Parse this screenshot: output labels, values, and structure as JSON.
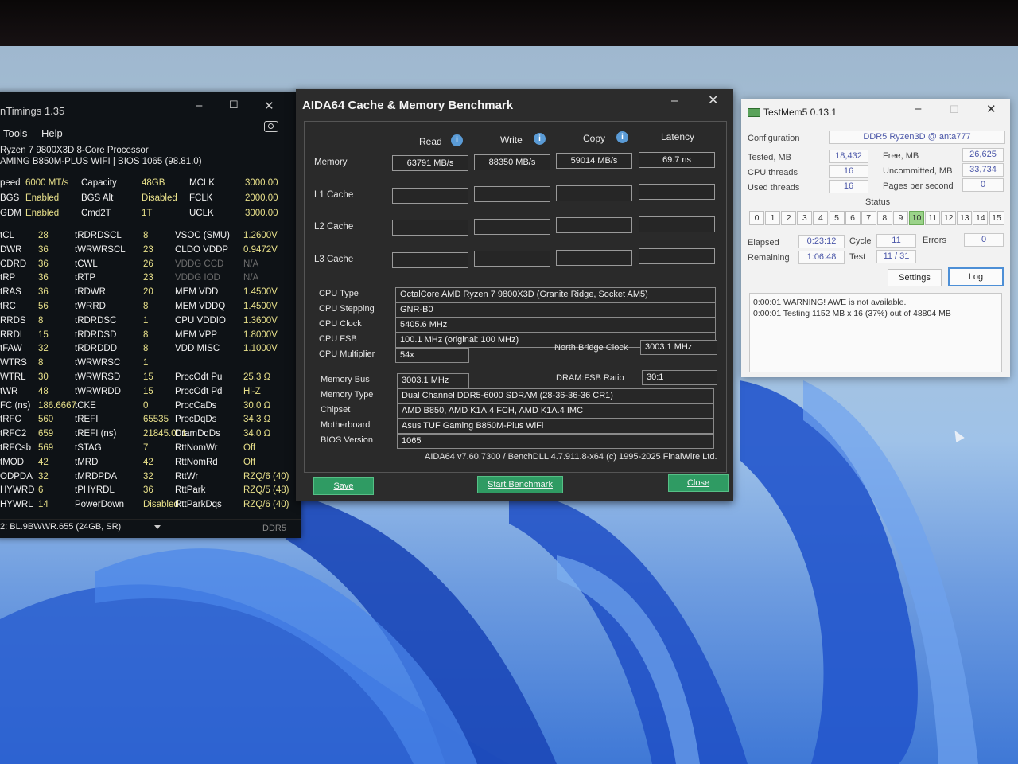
{
  "zentimings": {
    "title": "nTimings 1.35",
    "menu": [
      "Tools",
      "Help"
    ],
    "cpu": "Ryzen 7 9800X3D 8-Core Processor",
    "board": "AMING B850M-PLUS WIFI | BIOS 1065 (98.81.0)",
    "info_rows": [
      [
        [
          "peed",
          "6000 MT/s"
        ],
        [
          "Capacity",
          "48GB"
        ],
        [
          "MCLK",
          "3000.00"
        ]
      ],
      [
        [
          "BGS",
          "Enabled"
        ],
        [
          "BGS Alt",
          "Disabled"
        ],
        [
          "FCLK",
          "2000.00"
        ]
      ],
      [
        [
          "GDM",
          "Enabled"
        ],
        [
          "Cmd2T",
          "1T"
        ],
        [
          "UCLK",
          "3000.00"
        ]
      ]
    ],
    "timing_rows": [
      [
        [
          "tCL",
          "28"
        ],
        [
          "tRDRDSCL",
          "8"
        ],
        [
          "VSOC (SMU)",
          "1.2600V"
        ]
      ],
      [
        [
          "DWR",
          "36"
        ],
        [
          "tWRWRSCL",
          "23"
        ],
        [
          "CLDO VDDP",
          "0.9472V"
        ]
      ],
      [
        [
          "CDRD",
          "36"
        ],
        [
          "tCWL",
          "26"
        ],
        [
          "VDDG CCD",
          "N/A"
        ]
      ],
      [
        [
          "tRP",
          "36"
        ],
        [
          "tRTP",
          "23"
        ],
        [
          "VDDG IOD",
          "N/A"
        ]
      ],
      [
        [
          "tRAS",
          "36"
        ],
        [
          "tRDWR",
          "20"
        ],
        [
          "MEM VDD",
          "1.4500V"
        ]
      ],
      [
        [
          "tRC",
          "56"
        ],
        [
          "tWRRD",
          "8"
        ],
        [
          "MEM VDDQ",
          "1.4500V"
        ]
      ],
      [
        [
          "RRDS",
          "8"
        ],
        [
          "tRDRDSC",
          "1"
        ],
        [
          "CPU VDDIO",
          "1.3600V"
        ]
      ],
      [
        [
          "RRDL",
          "15"
        ],
        [
          "tRDRDSD",
          "8"
        ],
        [
          "MEM VPP",
          "1.8000V"
        ]
      ],
      [
        [
          "tFAW",
          "32"
        ],
        [
          "tRDRDDD",
          "8"
        ],
        [
          "VDD MISC",
          "1.1000V"
        ]
      ],
      [
        [
          "WTRS",
          "8"
        ],
        [
          "tWRWRSC",
          "1"
        ],
        [
          "",
          ""
        ]
      ],
      [
        [
          "WTRL",
          "30"
        ],
        [
          "tWRWRSD",
          "15"
        ],
        [
          "ProcOdt Pu",
          "25.3 Ω"
        ]
      ],
      [
        [
          "tWR",
          "48"
        ],
        [
          "tWRWRDD",
          "15"
        ],
        [
          "ProcOdt Pd",
          "Hi-Z"
        ]
      ],
      [
        [
          "FC (ns)",
          "186.6667"
        ],
        [
          "tCKE",
          "0"
        ],
        [
          "ProcCaDs",
          "30.0 Ω"
        ]
      ],
      [
        [
          "tRFC",
          "560"
        ],
        [
          "tREFI",
          "65535"
        ],
        [
          "ProcDqDs",
          "34.3 Ω"
        ]
      ],
      [
        [
          "tRFC2",
          "659"
        ],
        [
          "tREFI (ns)",
          "21845.001"
        ],
        [
          "DramDqDs",
          "34.0 Ω"
        ]
      ],
      [
        [
          "tRFCsb",
          "569"
        ],
        [
          "tSTAG",
          "7"
        ],
        [
          "RttNomWr",
          "Off"
        ]
      ],
      [
        [
          "tMOD",
          "42"
        ],
        [
          "tMRD",
          "42"
        ],
        [
          "RttNomRd",
          "Off"
        ]
      ],
      [
        [
          "ODPDA",
          "32"
        ],
        [
          "tMRDPDA",
          "32"
        ],
        [
          "RttWr",
          "RZQ/6 (40)"
        ]
      ],
      [
        [
          "HYWRD",
          "6"
        ],
        [
          "tPHYRDL",
          "36"
        ],
        [
          "RttPark",
          "RZQ/5 (48)"
        ]
      ],
      [
        [
          "HYWRL",
          "14"
        ],
        [
          "PowerDown",
          "Disabled"
        ],
        [
          "RttParkDqs",
          "RZQ/6 (40)"
        ]
      ]
    ],
    "module": "2: BL.9BWWR.655 (24GB, SR)",
    "mem_type": "DDR5"
  },
  "aida": {
    "title": "AIDA64 Cache & Memory Benchmark",
    "columns": [
      "Read",
      "Write",
      "Copy",
      "Latency"
    ],
    "rows": [
      {
        "label": "Memory",
        "values": [
          "63791 MB/s",
          "88350 MB/s",
          "59014 MB/s",
          "69.7 ns"
        ]
      },
      {
        "label": "L1 Cache",
        "values": [
          "",
          "",
          "",
          ""
        ]
      },
      {
        "label": "L2 Cache",
        "values": [
          "",
          "",
          "",
          ""
        ]
      },
      {
        "label": "L3 Cache",
        "values": [
          "",
          "",
          "",
          ""
        ]
      }
    ],
    "cpu_fields": [
      {
        "label": "CPU Type",
        "value": "OctalCore AMD Ryzen 7 9800X3D  (Granite Ridge, Socket AM5)"
      },
      {
        "label": "CPU Stepping",
        "value": "GNR-B0"
      },
      {
        "label": "CPU Clock",
        "value": "5405.6 MHz"
      },
      {
        "label": "CPU FSB",
        "value": "100.1 MHz  (original: 100 MHz)"
      },
      {
        "label": "CPU Multiplier",
        "value": "54x"
      }
    ],
    "nb_clock_label": "North Bridge Clock",
    "nb_clock": "3003.1 MHz",
    "mem_fields": [
      {
        "label": "Memory Bus",
        "value": "3003.1 MHz"
      },
      {
        "label": "Memory Type",
        "value": "Dual Channel DDR5-6000 SDRAM  (28-36-36-36 CR1)"
      },
      {
        "label": "Chipset",
        "value": "AMD B850, AMD K1A.4 FCH, AMD K1A.4 IMC"
      },
      {
        "label": "Motherboard",
        "value": "Asus TUF Gaming B850M-Plus WiFi"
      },
      {
        "label": "BIOS Version",
        "value": "1065"
      }
    ],
    "ratio_label": "DRAM:FSB Ratio",
    "ratio": "30:1",
    "copyright": "AIDA64 v7.60.7300 / BenchDLL 4.7.911.8-x64  (c) 1995-2025 FinalWire Ltd.",
    "buttons": {
      "save": "Save",
      "start": "Start Benchmark",
      "close": "Close"
    }
  },
  "testmem": {
    "title": "TestMem5  0.13.1",
    "config_label": "Configuration",
    "config": "DDR5 Ryzen3D @ anta777",
    "tested_label": "Tested, MB",
    "tested": "18,432",
    "free_label": "Free, MB",
    "free": "26,625",
    "threads_label": "CPU threads",
    "threads": "16",
    "uncommitted_label": "Uncommitted, MB",
    "uncommitted": "33,734",
    "used_label": "Used threads",
    "used": "16",
    "pages_label": "Pages per second",
    "pages": "0",
    "status_label": "Status",
    "status_cells": [
      "0",
      "1",
      "2",
      "3",
      "4",
      "5",
      "6",
      "7",
      "8",
      "9",
      "10",
      "11",
      "12",
      "13",
      "14",
      "15"
    ],
    "active_cell": "10",
    "elapsed_label": "Elapsed",
    "elapsed": "0:23:12",
    "cycle_label": "Cycle",
    "cycle": "11",
    "errors_label": "Errors",
    "errors": "0",
    "remaining_label": "Remaining",
    "remaining": "1:06:48",
    "test_label": "Test",
    "test": "11 / 31",
    "settings": "Settings",
    "log": "Log",
    "log_lines": [
      "0:00:01  WARNING! AWE is not available.",
      "0:00:01  Testing 1152 MB x 16 (37%) out of 48804 MB"
    ]
  }
}
